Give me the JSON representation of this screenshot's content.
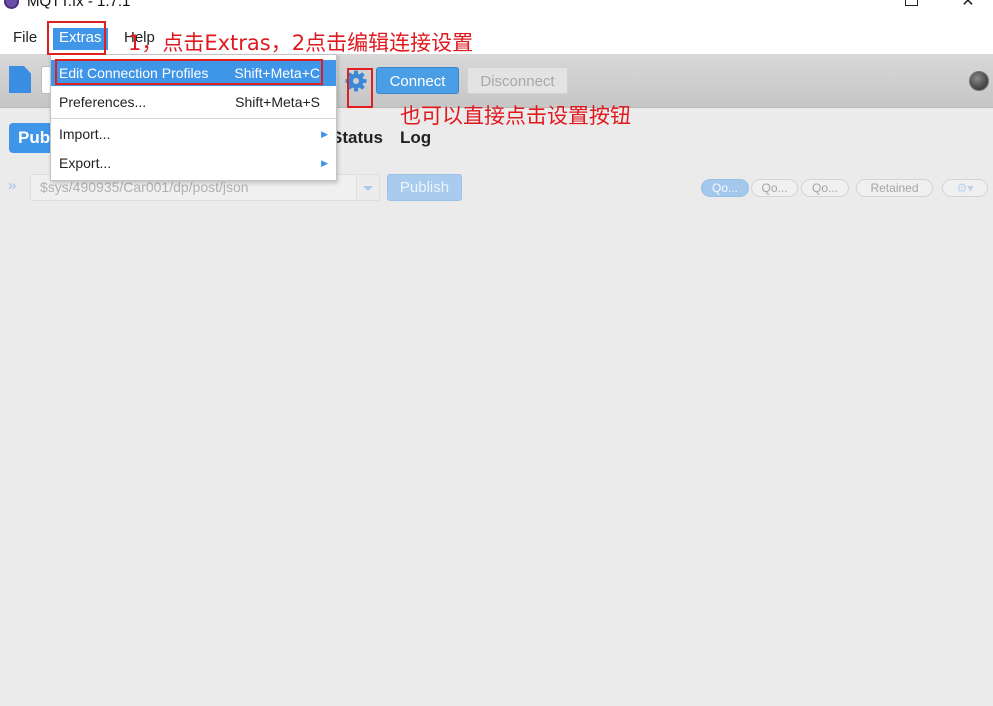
{
  "window": {
    "title": "MQTT.fx - 1.7.1"
  },
  "menubar": {
    "file": "File",
    "extras": "Extras",
    "help": "Help"
  },
  "toolbar": {
    "connect": "Connect",
    "disconnect": "Disconnect"
  },
  "tabs": {
    "publish": "Pub",
    "status": "Status",
    "log": "Log"
  },
  "publish": {
    "topic": "$sys/490935/Car001/dp/post/json",
    "button": "Publish",
    "qos0": "Qo...",
    "qos1": "Qo...",
    "qos2": "Qo...",
    "retained": "Retained"
  },
  "extras_menu": {
    "items": [
      {
        "label": "Edit Connection Profiles",
        "accel": "Shift+Meta+C"
      },
      {
        "label": "Preferences...",
        "accel": "Shift+Meta+S"
      },
      {
        "label": "Import...",
        "accel": ""
      },
      {
        "label": "Export...",
        "accel": ""
      }
    ]
  },
  "annotations": {
    "step_note": "1，点击Extras，2点击编辑连接设置",
    "gear_note": "也可以直接点击设置按钮"
  },
  "colors": {
    "accent": "#3f95e8",
    "annotation": "#e0191f"
  },
  "icons": [
    "app-icon",
    "new-document-icon",
    "gear-icon",
    "status-light-icon",
    "double-chevron-icon",
    "dropdown-arrow-icon",
    "submenu-arrow-icon"
  ]
}
